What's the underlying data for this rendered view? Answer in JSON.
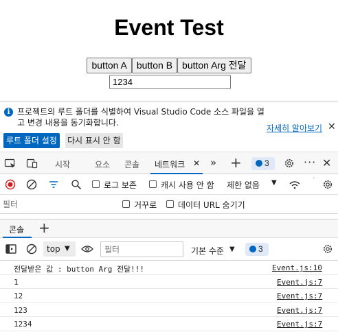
{
  "page": {
    "title": "Event Test",
    "buttons": [
      {
        "label": "button A"
      },
      {
        "label": "button B"
      },
      {
        "label": "button Arg 전달"
      }
    ],
    "input_value": "1234"
  },
  "infobar": {
    "message": "프로젝트의 루트 폴더를 식별하여 Visual Studio Code 소스 파일을 열고 변경 내용을 동기화합니다.",
    "link": "자세히 알아보기",
    "primary_button": "루트 폴더 설정",
    "secondary_button": "다시 표시 안 함"
  },
  "devtools_tabs": {
    "items": [
      {
        "label": "시작"
      },
      {
        "label": "요소"
      },
      {
        "label": "콘솔"
      },
      {
        "label": "네트워크"
      }
    ],
    "active": "네트워크",
    "issue_count": "3"
  },
  "network_toolbar": {
    "preserve_log": "로그 보존",
    "disable_cache": "캐시 사용 안 함",
    "throttling": "제한 없음"
  },
  "network_filter": {
    "placeholder": "필터",
    "invert": "거꾸로",
    "hide_data_urls": "데이터 URL 숨기기"
  },
  "drawer": {
    "tab": "콘솔"
  },
  "console_toolbar": {
    "context": "top",
    "filter_placeholder": "필터",
    "level": "기본 수준",
    "issue_count": "3"
  },
  "console_log": [
    {
      "message": "전달받은 값 : button Arg 전달!!!",
      "source": "Event.js:10"
    },
    {
      "message": "1",
      "source": "Event.js:7"
    },
    {
      "message": "12",
      "source": "Event.js:7"
    },
    {
      "message": "123",
      "source": "Event.js:7"
    },
    {
      "message": "1234",
      "source": "Event.js:7"
    }
  ],
  "colors": {
    "accent": "#0067c0",
    "record": "#d21e1e"
  }
}
